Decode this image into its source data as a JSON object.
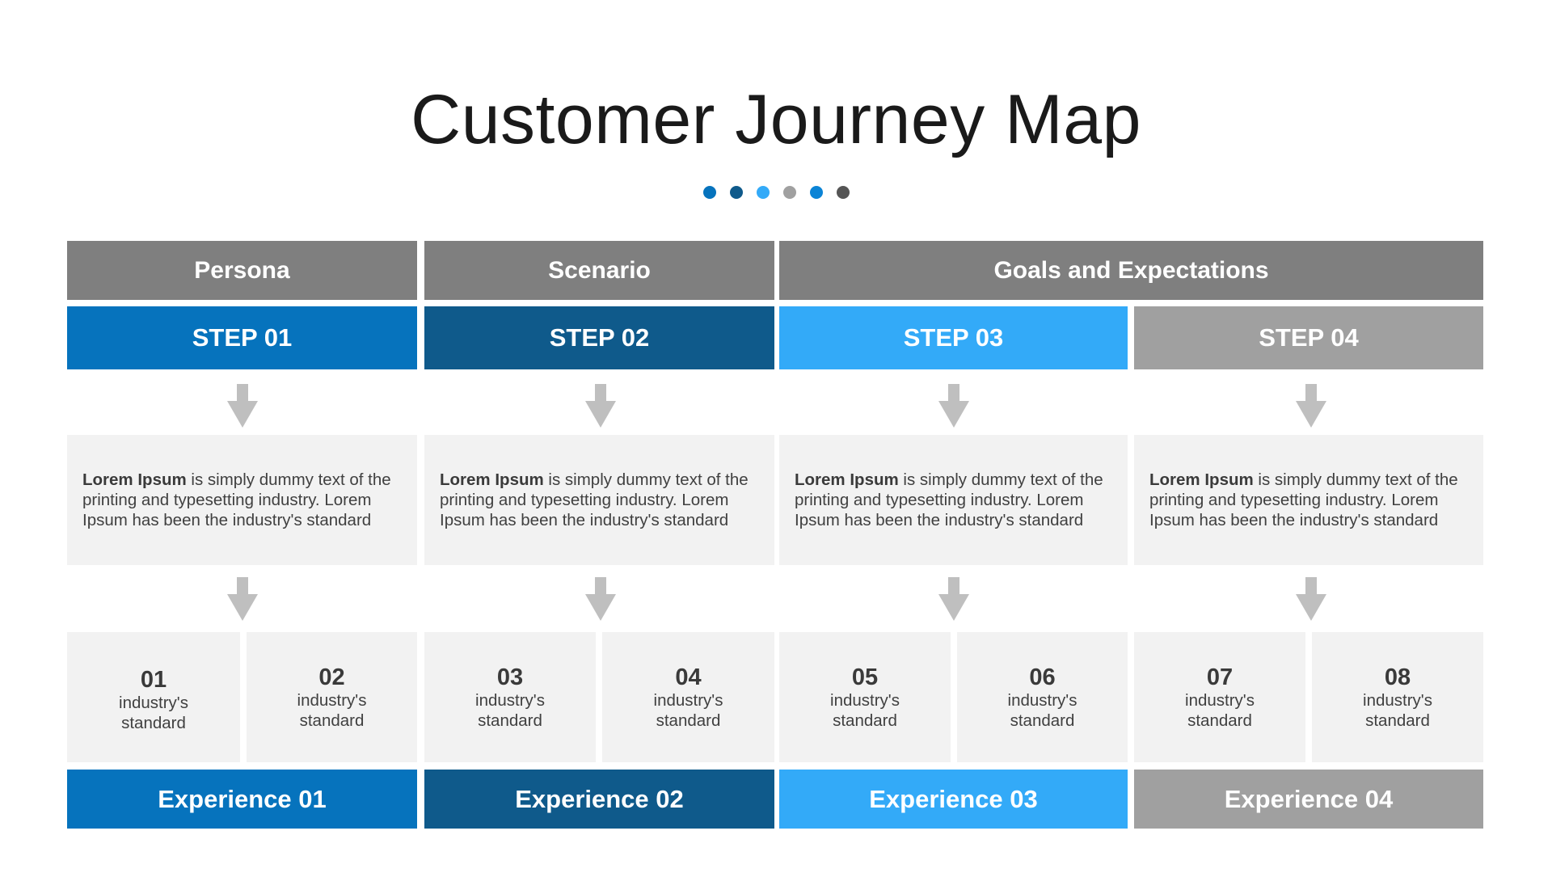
{
  "title": "Customer Journey Map",
  "dot_colors": [
    "#0673bd",
    "#0f5a8b",
    "#33aaf8",
    "#a0a0a0",
    "#0b84d6",
    "#555555"
  ],
  "headers": [
    {
      "label": "Persona"
    },
    {
      "label": "Scenario"
    },
    {
      "label": "Goals and Expectations"
    }
  ],
  "steps": [
    {
      "label": "STEP 01",
      "color": "#0673bd"
    },
    {
      "label": "STEP 02",
      "color": "#0f5a8b"
    },
    {
      "label": "STEP 03",
      "color": "#33aaf8"
    },
    {
      "label": "STEP 04",
      "color": "#a0a0a0"
    }
  ],
  "descriptions": [
    {
      "bold": "Lorem Ipsum",
      "text": " is simply dummy text of the printing and typesetting industry. Lorem Ipsum has been the industry's standard"
    },
    {
      "bold": "Lorem Ipsum",
      "text": " is simply dummy text of the printing and typesetting industry. Lorem Ipsum has been the industry's standard"
    },
    {
      "bold": "Lorem Ipsum",
      "text": " is simply dummy text of the printing and typesetting industry. Lorem Ipsum has been the industry's standard"
    },
    {
      "bold": "Lorem Ipsum",
      "text": " is simply dummy text of the printing and typesetting industry. Lorem Ipsum has been the industry's standard"
    }
  ],
  "items": [
    {
      "num": "01",
      "label1": "industry's",
      "label2": "standard"
    },
    {
      "num": "02",
      "label1": "industry's",
      "label2": "standard"
    },
    {
      "num": "03",
      "label1": "industry's",
      "label2": "standard"
    },
    {
      "num": "04",
      "label1": "industry's",
      "label2": "standard"
    },
    {
      "num": "05",
      "label1": "industry's",
      "label2": "standard"
    },
    {
      "num": "06",
      "label1": "industry's",
      "label2": "standard"
    },
    {
      "num": "07",
      "label1": "industry's",
      "label2": "standard"
    },
    {
      "num": "08",
      "label1": "industry's",
      "label2": "standard"
    }
  ],
  "experiences": [
    {
      "label": "Experience 01",
      "color": "#0673bd"
    },
    {
      "label": "Experience 02",
      "color": "#0f5a8b"
    },
    {
      "label": "Experience 03",
      "color": "#33aaf8"
    },
    {
      "label": "Experience 04",
      "color": "#a0a0a0"
    }
  ],
  "colors": {
    "header_bg": "#7f7f7f",
    "box_bg": "#f2f2f2",
    "arrow": "#bfbfbf",
    "text": "#404040"
  }
}
